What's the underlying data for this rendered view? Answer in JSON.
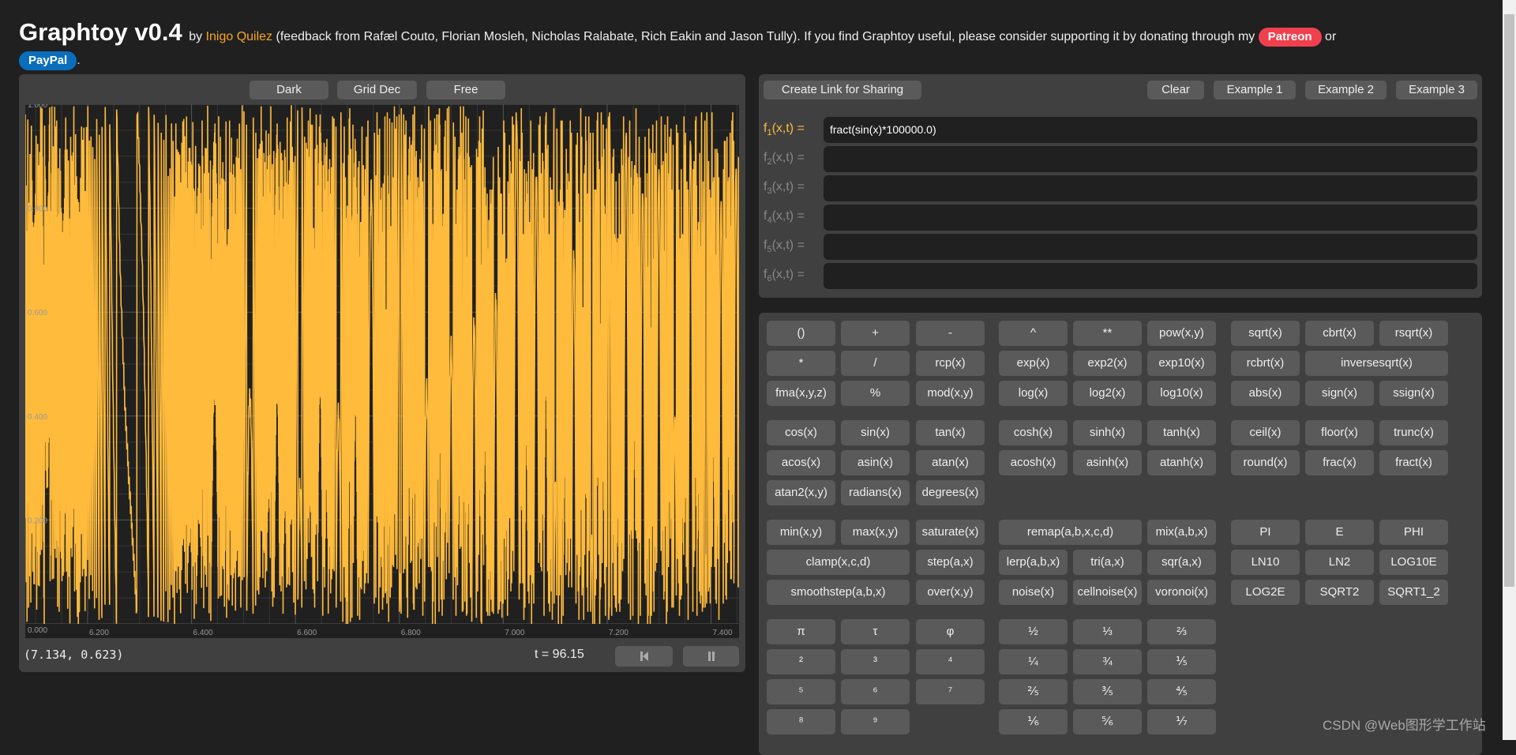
{
  "header": {
    "title": "Graphtoy v0.4",
    "by": "by",
    "author": "Inigo Quilez",
    "credits": "(feedback from Rafæl Couto, Florian Mosleh, Nicholas Ralabate, Rich Eakin and Jason Tully). If you find Graphtoy useful, please consider supporting it by donating through my",
    "patreon": "Patreon",
    "or": "or",
    "paypal": "PayPal",
    "period": ".",
    "link_color": "#f5a623",
    "patreon_color": "#f0404e",
    "paypal_color": "#0a6ebd"
  },
  "plot_toolbar": {
    "dark": "Dark",
    "grid": "Grid Dec",
    "free": "Free"
  },
  "plot_footer": {
    "coords": "(7.134, 0.623)",
    "time": "t = 96.15",
    "rewind_icon": "skip-back-icon",
    "pause_icon": "pause-icon"
  },
  "chart_data": {
    "type": "line",
    "expression": "fract(sin(x)*100000.0)",
    "xlim": [
      6.08,
      7.455
    ],
    "ylim": [
      0,
      1
    ],
    "xticks": [
      "6.200",
      "6.400",
      "6.600",
      "6.800",
      "7.000",
      "7.200",
      "7.400"
    ],
    "xtick_values": [
      6.2,
      6.4,
      6.6,
      6.8,
      7.0,
      7.2,
      7.4
    ],
    "yticks": [
      "0.000",
      "0.200",
      "0.400",
      "0.600",
      "0.800",
      "1.000"
    ],
    "ytick_values": [
      0,
      0.2,
      0.4,
      0.6,
      0.8,
      1.0
    ],
    "grid": true,
    "minor_step": 0.05,
    "series_color": "#ffbb3c",
    "background": "#202020"
  },
  "editor": {
    "share": "Create Link for Sharing",
    "clear": "Clear",
    "ex1": "Example 1",
    "ex2": "Example 2",
    "ex3": "Example 3",
    "functions": [
      {
        "name": "f",
        "sub": "1",
        "args": "(x,t) =",
        "value": "fract(sin(x)*100000.0)",
        "active": true
      },
      {
        "name": "f",
        "sub": "2",
        "args": "(x,t) =",
        "value": "",
        "active": false
      },
      {
        "name": "f",
        "sub": "3",
        "args": "(x,t) =",
        "value": "",
        "active": false
      },
      {
        "name": "f",
        "sub": "4",
        "args": "(x,t) =",
        "value": "",
        "active": false
      },
      {
        "name": "f",
        "sub": "5",
        "args": "(x,t) =",
        "value": "",
        "active": false
      },
      {
        "name": "f",
        "sub": "6",
        "args": "(x,t) =",
        "value": "",
        "active": false
      }
    ],
    "active_color": "#ffbb3c",
    "inactive_color": "#888888"
  },
  "keypad": [
    [
      [
        "()",
        "+",
        "-",
        "^",
        "**",
        "pow(x,y)",
        "sqrt(x)",
        "cbrt(x)",
        "rsqrt(x)"
      ],
      [
        "*",
        "/",
        "rcp(x)",
        "exp(x)",
        "exp2(x)",
        "exp10(x)",
        "rcbrt(x)",
        {
          "label": "inversesqrt(x)",
          "span": 2
        }
      ],
      [
        "fma(x,y,z)",
        "%",
        "mod(x,y)",
        "log(x)",
        "log2(x)",
        "log10(x)",
        "abs(x)",
        "sign(x)",
        "ssign(x)"
      ]
    ],
    [
      [
        "cos(x)",
        "sin(x)",
        "tan(x)",
        "cosh(x)",
        "sinh(x)",
        "tanh(x)",
        "ceil(x)",
        "floor(x)",
        "trunc(x)"
      ],
      [
        "acos(x)",
        "asin(x)",
        "atan(x)",
        "acosh(x)",
        "asinh(x)",
        "atanh(x)",
        "round(x)",
        "frac(x)",
        "fract(x)"
      ],
      [
        "atan2(x,y)",
        "radians(x)",
        "degrees(x)"
      ]
    ],
    [
      [
        "min(x,y)",
        "max(x,y)",
        "saturate(x)",
        {
          "label": "remap(a,b,x,c,d)",
          "span": 2
        },
        "mix(a,b,x)",
        "PI",
        "E",
        "PHI"
      ],
      [
        {
          "label": "clamp(x,c,d)",
          "span": 2
        },
        "step(a,x)",
        "lerp(a,b,x)",
        "tri(a,x)",
        "sqr(a,x)",
        "LN10",
        "LN2",
        "LOG10E"
      ],
      [
        {
          "label": "smoothstep(a,b,x)",
          "span": 2
        },
        "over(x,y)",
        "noise(x)",
        "cellnoise(x)",
        "voronoi(x)",
        "LOG2E",
        "SQRT2",
        "SQRT1_2"
      ]
    ],
    [
      [
        "π",
        "τ",
        "φ",
        "½",
        "⅓",
        "⅔"
      ],
      [
        "²",
        "³",
        "⁴",
        "¼",
        "¾",
        "⅕"
      ],
      [
        "⁵",
        "⁶",
        "⁷",
        "⅖",
        "⅗",
        "⅘"
      ],
      [
        "⁸",
        "⁹",
        null,
        "⅙",
        "⅚",
        "⅐"
      ]
    ]
  ],
  "watermark": "CSDN @Web图形学工作站"
}
